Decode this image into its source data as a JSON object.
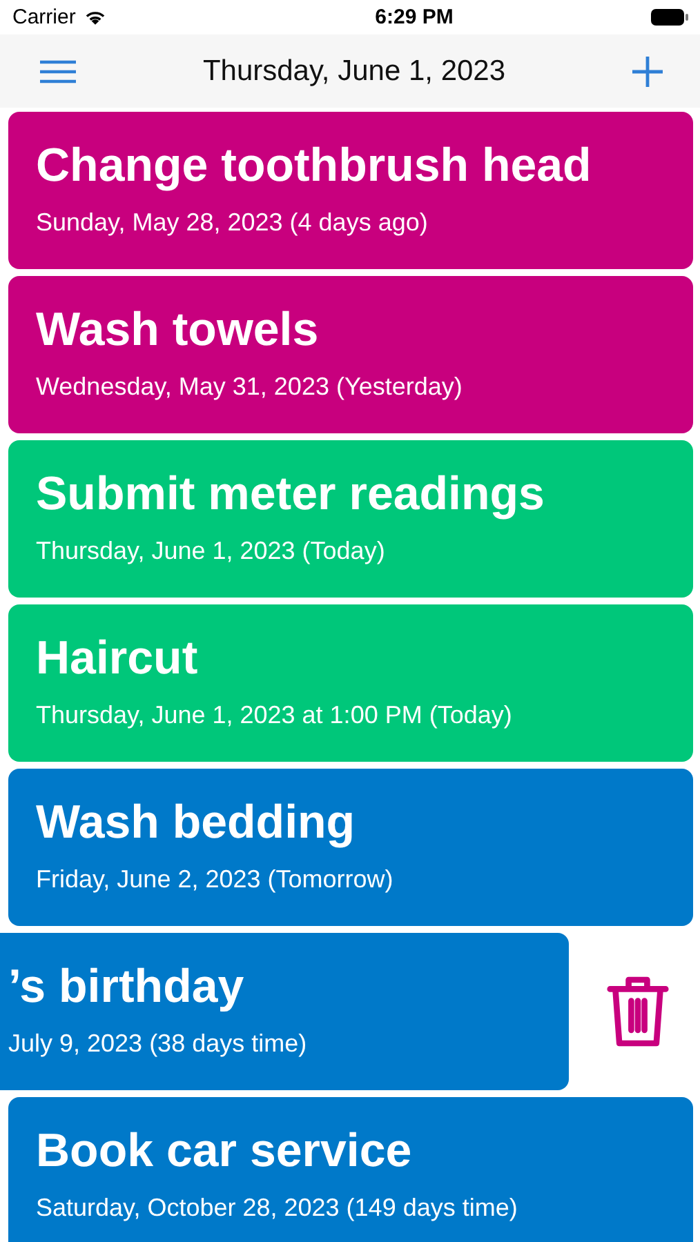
{
  "status_bar": {
    "carrier": "Carrier",
    "time": "6:29 PM"
  },
  "nav": {
    "title": "Thursday, June 1, 2023"
  },
  "reminders": [
    {
      "title": "Change toothbrush head",
      "date": "Sunday, May 28, 2023 (4 days ago)",
      "color": "#c8007e",
      "swiped": false
    },
    {
      "title": "Wash towels",
      "date": "Wednesday, May 31, 2023 (Yesterday)",
      "color": "#c8007e",
      "swiped": false
    },
    {
      "title": "Submit meter readings",
      "date": "Thursday, June 1, 2023 (Today)",
      "color": "#00c77a",
      "swiped": false
    },
    {
      "title": "Haircut",
      "date": "Thursday, June 1, 2023 at 1:00 PM (Today)",
      "color": "#00c77a",
      "swiped": false
    },
    {
      "title": "Wash bedding",
      "date": "Friday, June 2, 2023 (Tomorrow)",
      "color": "#0079c9",
      "swiped": false
    },
    {
      "title": "’s birthday",
      "date": "July 9, 2023 (38 days time)",
      "color": "#0079c9",
      "swiped": true
    },
    {
      "title": "Book car service",
      "date": "Saturday, October 28, 2023 (149 days time)",
      "color": "#0079c9",
      "swiped": false
    }
  ]
}
